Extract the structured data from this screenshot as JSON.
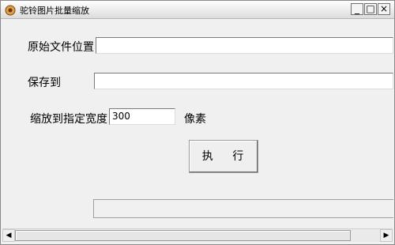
{
  "window": {
    "title": "驼铃图片批量缩放",
    "controls": {
      "minimize": "_",
      "maximize": "□",
      "close": "×"
    }
  },
  "form": {
    "source_label": "原始文件位置",
    "source_value": "",
    "save_label": "保存到",
    "save_value": "",
    "width_label": "缩放到指定宽度",
    "width_value": "300",
    "width_unit": "像素"
  },
  "actions": {
    "execute_label": "执 行"
  },
  "scrollbar": {
    "left_arrow": "◀",
    "right_arrow": "▶",
    "thumb_fraction": 0.92
  }
}
